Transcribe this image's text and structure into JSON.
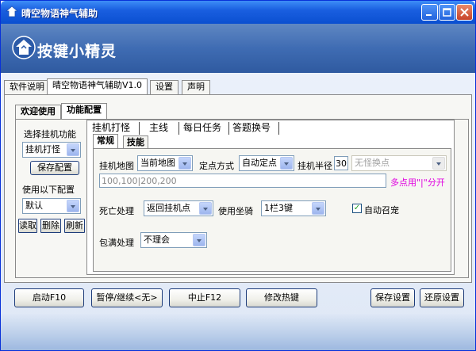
{
  "window": {
    "title": "晴空物语神气辅助"
  },
  "banner": {
    "logo_text": "按键小精灵"
  },
  "top_tabs": [
    "软件说明",
    "晴空物语神气辅助V1.0",
    "设置",
    "声明"
  ],
  "sub_tabs": [
    "欢迎使用",
    "功能配置"
  ],
  "left": {
    "select_func_label": "选择挂机功能",
    "func_value": "挂机打怪",
    "save_config": "保存配置",
    "use_config_label": "使用以下配置",
    "config_value": "默认",
    "read_btn": "读取",
    "delete_btn": "删除",
    "refresh_btn": "刷新"
  },
  "func_tabs": [
    "挂机打怪",
    "主线",
    "每日任务",
    "答题换号"
  ],
  "inner_tabs": [
    "常规",
    "技能"
  ],
  "form": {
    "map_label": "挂机地图",
    "map_value": "当前地图",
    "point_label": "定点方式",
    "point_value": "自动定点",
    "radius_label": "挂机半径",
    "radius_value": "30",
    "no_monster_value": "无怪换点",
    "points_value": "100,100|200,200",
    "points_hint": "多点用\"|\"分开",
    "death_label": "死亡处理",
    "death_value": "返回挂机点",
    "mount_label": "使用坐骑",
    "mount_value": "1栏3键",
    "auto_pet_label": "自动召宠",
    "auto_pet_checked": "✓",
    "bag_label": "包满处理",
    "bag_value": "不理会"
  },
  "bottom": {
    "start": "启动F10",
    "pause": "暂停/继续<无>",
    "stop": "中止F12",
    "hotkey": "修改热键",
    "save_settings": "保存设置",
    "restore_settings": "还原设置"
  },
  "colors": {
    "title_blue": "#0a4fd0",
    "banner_blue": "#3f6cb3",
    "hint_magenta": "#e000e0"
  }
}
